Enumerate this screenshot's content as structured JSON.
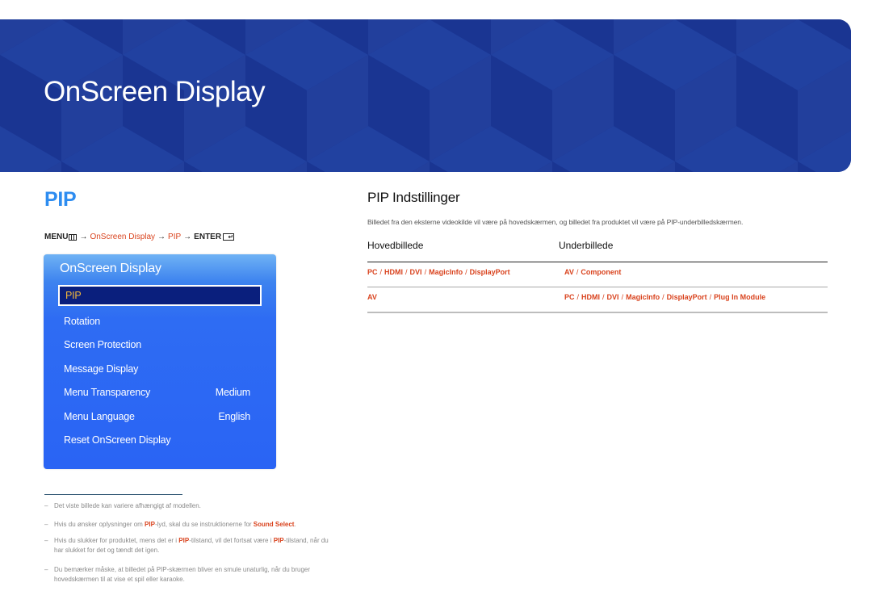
{
  "banner": {
    "title": "OnScreen Display",
    "color": "#1c3797"
  },
  "left": {
    "heading": "PIP",
    "menu_path": {
      "menu_label": "MENU",
      "menu_icon": "menu-icon",
      "arrow": "→",
      "step1": "OnScreen Display",
      "step2": "PIP",
      "enter_label": "ENTER",
      "enter_icon": "enter-icon"
    },
    "osd": {
      "title": "OnScreen Display",
      "items": [
        {
          "label": "PIP",
          "value": "",
          "selected": true
        },
        {
          "label": "Rotation",
          "value": ""
        },
        {
          "label": "Screen Protection",
          "value": ""
        },
        {
          "label": "Message Display",
          "value": ""
        },
        {
          "label": "Menu Transparency",
          "value": "Medium"
        },
        {
          "label": "Menu Language",
          "value": "English"
        },
        {
          "label": "Reset OnScreen Display",
          "value": ""
        }
      ]
    },
    "notes": [
      {
        "dash": "–",
        "parts": [
          "Det viste billede kan variere afhængigt af modellen."
        ]
      },
      {
        "dash": "–",
        "parts": [
          "Hvis du ønsker oplysninger om ",
          "PIP",
          "-lyd, skal du se instruktionerne for ",
          "Sound Select",
          "."
        ]
      },
      {
        "dash": "–",
        "parts": [
          "Hvis du slukker for produktet, mens det er i ",
          "PIP",
          "-tilstand, vil det fortsat være i ",
          "PIP",
          "-tilstand, når du har slukket for det og tændt det igen."
        ]
      },
      {
        "dash": "–",
        "parts": [
          "Du bemærker måske, at billedet på PIP-skærmen bliver en smule unaturlig, når du bruger hovedskærmen til at vise et spil eller karaoke."
        ]
      }
    ]
  },
  "right": {
    "title": "PIP Indstillinger",
    "description": "Billedet fra den eksterne videokilde vil være på hovedskærmen, og billedet fra produktet vil være på PIP-underbilledskærmen.",
    "table": {
      "headers": [
        "Hovedbillede",
        "Underbillede"
      ],
      "rows": [
        {
          "main": [
            "PC",
            "HDMI",
            "DVI",
            "MagicInfo",
            "DisplayPort"
          ],
          "sub": [
            "AV",
            "Component"
          ]
        },
        {
          "main": [
            "AV"
          ],
          "sub": [
            "PC",
            "HDMI",
            "DVI",
            "MagicInfo",
            "DisplayPort",
            "Plug In Module"
          ]
        }
      ]
    }
  },
  "colors": {
    "accent_red": "#d9431e",
    "heading_blue": "#2d8cf0",
    "osd_blue": "#2a64f4",
    "osd_selected": "#0a1f7d",
    "osd_selected_text": "#f3b83a"
  }
}
